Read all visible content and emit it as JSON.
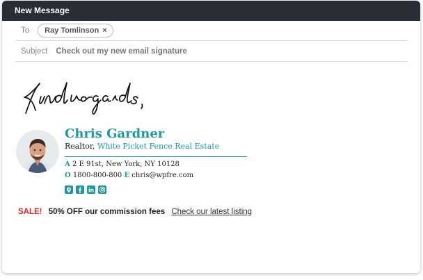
{
  "window": {
    "title": "New Message"
  },
  "to": {
    "label": "To",
    "recipient": "Ray Tomlinson",
    "remove_symbol": "×"
  },
  "subject": {
    "label": "Subject",
    "value": "Check out my new email signature"
  },
  "body": {
    "signoff": "Kind regards,"
  },
  "signature": {
    "name": "Chris Gardner",
    "role": "Realtor,",
    "company": "White Picket Fence Real Estate",
    "address_key": "A",
    "address": "2 E 91st, New York, NY 10128",
    "phone_key": "O",
    "phone": "1800-800-800",
    "email_key": "E",
    "email": "chris@wpfre.com",
    "social_icons": [
      "location-icon",
      "facebook-icon",
      "linkedin-icon",
      "instagram-icon"
    ],
    "accent_color": "#2096a0"
  },
  "promo": {
    "sale_label": "SALE!",
    "offer_text": "50% OFF our commission fees",
    "link_text": "Check our latest listing",
    "sale_color": "#d92b2b"
  }
}
